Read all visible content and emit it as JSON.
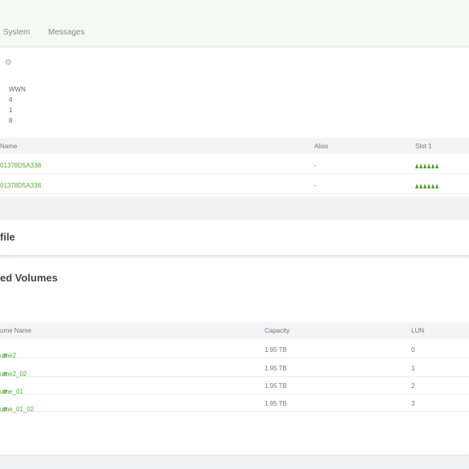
{
  "nav": {
    "tabs": [
      "System",
      "Messages"
    ]
  },
  "host_card": {
    "wwn_label": "WWN",
    "wwn_values": [
      "4",
      "1",
      "8"
    ],
    "table": {
      "headers": [
        "Name",
        "Alias",
        "Slot 1"
      ],
      "rows": [
        {
          "name": "01378D5A338",
          "alias": "-"
        },
        {
          "name": "01378D5A338",
          "alias": "-"
        }
      ]
    }
  },
  "profile": {
    "title": "file"
  },
  "volumes": {
    "title": "ed Volumes",
    "table": {
      "headers": [
        "ume Name",
        "Capacity",
        "LUN"
      ],
      "rows": [
        {
          "name": "ume2",
          "capacity": "1.95 TB",
          "lun": "0"
        },
        {
          "name": "ume2_02",
          "capacity": "1.95 TB",
          "lun": "1"
        },
        {
          "name": "ume_01",
          "capacity": "1.95 TB",
          "lun": "2"
        },
        {
          "name": "ume_01_02",
          "capacity": "1.95 TB",
          "lun": "3"
        }
      ]
    }
  },
  "colors": {
    "accent": "#5aa83c",
    "port_green": "#4c9a2a",
    "nav_bg": "#f4faf2"
  },
  "icons": {
    "settings": "gear-icon",
    "volume_link": "link-icon",
    "port": "port-icon"
  }
}
